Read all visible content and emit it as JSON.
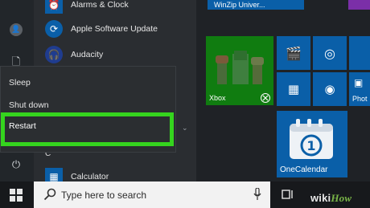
{
  "app_list": {
    "items": [
      {
        "label": "Alarms & Clock",
        "icon": "alarm-clock-icon"
      },
      {
        "label": "Apple Software Update",
        "icon": "apple-update-icon"
      },
      {
        "label": "Audacity",
        "icon": "audacity-icon"
      },
      {
        "label": "Calculator",
        "icon": "calculator-icon"
      }
    ],
    "section_letter": "C"
  },
  "power_menu": {
    "sleep_label": "Sleep",
    "shutdown_label": "Shut down",
    "restart_label": "Restart"
  },
  "tiles": {
    "winzip_label": "WinZip Univer...",
    "xbox_label": "Xbox",
    "onecalendar_label": "OneCalendar",
    "photos_label": "Phot"
  },
  "taskbar": {
    "search_placeholder": "Type here to search"
  },
  "watermark": {
    "wiki": "wiki",
    "how": "How"
  },
  "colors": {
    "highlight": "#35d41e",
    "tile_blue": "#0a5fa8",
    "xbox_green": "#107c10"
  }
}
